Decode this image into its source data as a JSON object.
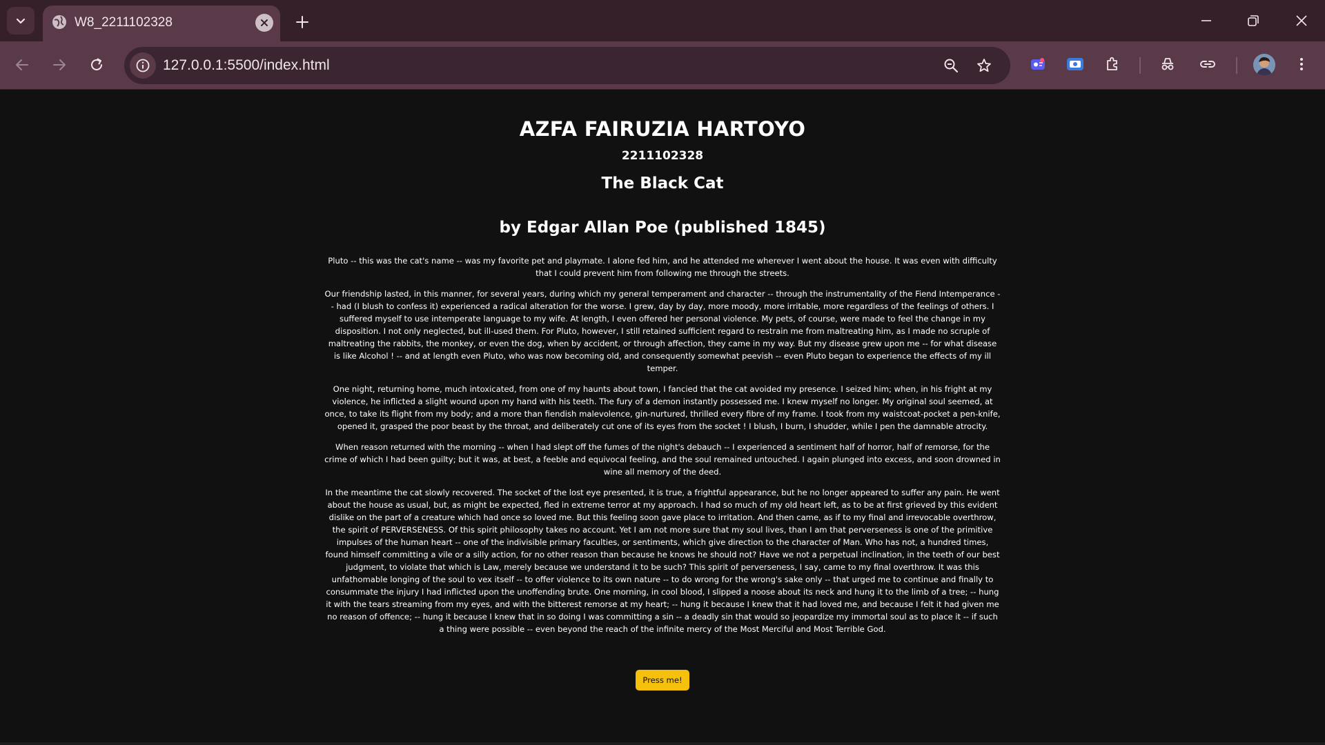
{
  "browser": {
    "tab": {
      "title": "W8_2211102328",
      "favicon": "globe-icon"
    },
    "address_bar": {
      "url": "127.0.0.1:5500/index.html"
    }
  },
  "page": {
    "author_name": "AZFA FAIRUZIA HARTOYO",
    "student_id": "2211102328",
    "story_title": "The Black Cat",
    "story_byline": "by Edgar Allan Poe (published 1845)",
    "paragraphs": [
      "Pluto -- this was the cat's name -- was my favorite pet and playmate. I alone fed him, and he attended me wherever I went about the house. It was even with difficulty that I could prevent him from following me through the streets.",
      "Our friendship lasted, in this manner, for several years, during which my general temperament and character -- through the instrumentality of the Fiend Intemperance -- had (I blush to confess it) experienced a radical alteration for the worse. I grew, day by day, more moody, more irritable, more regardless of the feelings of others. I suffered myself to use intemperate language to my wife. At length, I even offered her personal violence. My pets, of course, were made to feel the change in my disposition. I not only neglected, but ill-used them. For Pluto, however, I still retained sufficient regard to restrain me from maltreating him, as I made no scruple of maltreating the rabbits, the monkey, or even the dog, when by accident, or through affection, they came in my way. But my disease grew upon me -- for what disease is like Alcohol ! -- and at length even Pluto, who was now becoming old, and consequently somewhat peevish -- even Pluto began to experience the effects of my ill temper.",
      "One night, returning home, much intoxicated, from one of my haunts about town, I fancied that the cat avoided my presence. I seized him; when, in his fright at my violence, he inflicted a slight wound upon my hand with his teeth. The fury of a demon instantly possessed me. I knew myself no longer. My original soul seemed, at once, to take its flight from my body; and a more than fiendish malevolence, gin-nurtured, thrilled every fibre of my frame. I took from my waistcoat-pocket a pen-knife, opened it, grasped the poor beast by the throat, and deliberately cut one of its eyes from the socket ! I blush, I burn, I shudder, while I pen the damnable atrocity.",
      "When reason returned with the morning -- when I had slept off the fumes of the night's debauch -- I experienced a sentiment half of horror, half of remorse, for the crime of which I had been guilty; but it was, at best, a feeble and equivocal feeling, and the soul remained untouched. I again plunged into excess, and soon drowned in wine all memory of the deed.",
      "In the meantime the cat slowly recovered. The socket of the lost eye presented, it is true, a frightful appearance, but he no longer appeared to suffer any pain. He went about the house as usual, but, as might be expected, fled in extreme terror at my approach. I had so much of my old heart left, as to be at first grieved by this evident dislike on the part of a creature which had once so loved me. But this feeling soon gave place to irritation. And then came, as if to my final and irrevocable overthrow, the spirit of PERVERSENESS. Of this spirit philosophy takes no account. Yet I am not more sure that my soul lives, than I am that perverseness is one of the primitive impulses of the human heart -- one of the indivisible primary faculties, or sentiments, which give direction to the character of Man. Who has not, a hundred times, found himself committing a vile or a silly action, for no other reason than because he knows he should not? Have we not a perpetual inclination, in the teeth of our best judgment, to violate that which is Law, merely because we understand it to be such? This spirit of perverseness, I say, came to my final overthrow. It was this unfathomable longing of the soul to vex itself -- to offer violence to its own nature -- to do wrong for the wrong's sake only -- that urged me to continue and finally to consummate the injury I had inflicted upon the unoffending brute. One morning, in cool blood, I slipped a noose about its neck and hung it to the limb of a tree; -- hung it with the tears streaming from my eyes, and with the bitterest remorse at my heart; -- hung it because I knew that it had loved me, and because I felt it had given me no reason of offence; -- hung it because I knew that in so doing I was committing a sin -- a deadly sin that would so jeopardize my immortal soul as to place it -- if such a thing were possible -- even beyond the reach of the infinite mercy of the Most Merciful and Most Terrible God."
    ],
    "button_label": "Press me!"
  },
  "colors": {
    "tabbar_bg": "#35202a",
    "toolbar_bg": "#5a3a48",
    "page_bg": "#111111",
    "button_bg": "#f5c10c"
  }
}
